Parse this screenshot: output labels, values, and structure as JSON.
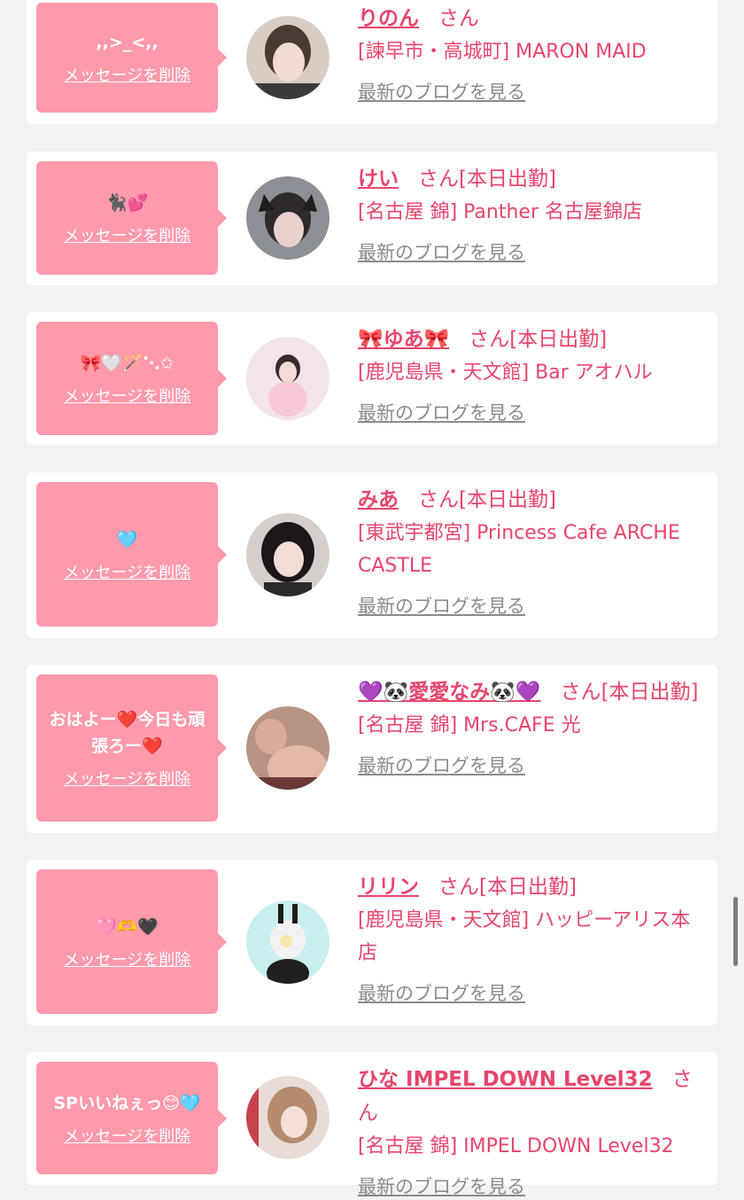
{
  "cards": [
    {
      "message": ",,>_<,,",
      "delete_label": "メッセージを削除",
      "name": "りのん",
      "suffix": "さん",
      "shop": "[諫早市・高城町] MARON MAID",
      "blog_label": "最新のブログを見る"
    },
    {
      "message": "🐈‍⬛💕",
      "delete_label": "メッセージを削除",
      "name": "けい",
      "suffix": "さん[本日出勤]",
      "shop": "[名古屋 錦] Panther 名古屋錦店",
      "blog_label": "最新のブログを見る"
    },
    {
      "message": "🎀🤍🪄⋱✩",
      "delete_label": "メッセージを削除",
      "name": "🎀ゆあ🎀",
      "suffix": "さん[本日出勤]",
      "shop": "[鹿児島県・天文館] Bar アオハル",
      "blog_label": "最新のブログを見る"
    },
    {
      "message": "🩵",
      "delete_label": "メッセージを削除",
      "name": "みあ",
      "suffix": "さん[本日出勤]",
      "shop": "[東武宇都宮] Princess Cafe ARCHE CASTLE",
      "blog_label": "最新のブログを見る"
    },
    {
      "message": "おはよー❤️今日も頑張ろー❤️",
      "delete_label": "メッセージを削除",
      "name": "💜🐼愛愛なみ🐼💜",
      "suffix": "さん[本日出勤]",
      "shop": "[名古屋 錦] Mrs.CAFE 光",
      "blog_label": "最新のブログを見る"
    },
    {
      "message": "🩷🫶🖤",
      "delete_label": "メッセージを削除",
      "name": "リリン",
      "suffix": "さん[本日出勤]",
      "shop": "[鹿児島県・天文館] ハッピーアリス本店",
      "blog_label": "最新のブログを見る"
    },
    {
      "message": "SPいいねぇっ😊🩵",
      "delete_label": "メッセージを削除",
      "name": "ひな IMPEL DOWN Level32",
      "suffix": "さん",
      "shop": "[名古屋 錦] IMPEL DOWN Level32",
      "blog_label": "最新のブログを見る"
    }
  ],
  "colors": {
    "page_bg": "#f2f2f2",
    "card_bg": "#ffffff",
    "bubble_bg": "#ff99ac",
    "accent_text": "#e8446d",
    "link_gray": "#8a8a8a"
  }
}
